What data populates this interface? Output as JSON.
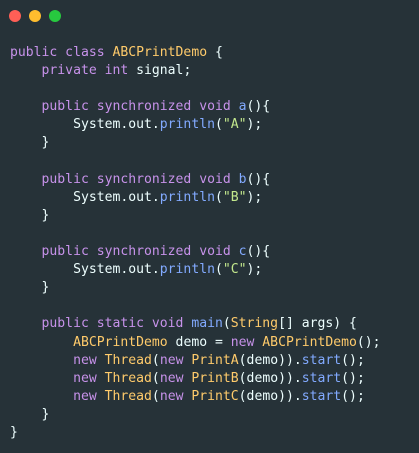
{
  "window": {
    "controls": [
      {
        "name": "close",
        "color": "#ff5f56"
      },
      {
        "name": "minimize",
        "color": "#ffbd2e"
      },
      {
        "name": "maximize",
        "color": "#27c93f"
      }
    ]
  },
  "colors": {
    "background": "#263238",
    "keyword": "#c792ea",
    "type": "#ffcb6b",
    "function": "#82aaff",
    "string": "#c3e88d",
    "text": "#eeffff",
    "punctuation": "#89ddff"
  },
  "code": {
    "lines": [
      [
        {
          "t": "public class ",
          "k": "keyword"
        },
        {
          "t": "ABCPrintDemo",
          "k": "type"
        },
        {
          "t": " {",
          "k": "plain"
        }
      ],
      [
        {
          "t": "    private int ",
          "k": "keyword"
        },
        {
          "t": "signal;",
          "k": "plain"
        }
      ],
      [],
      [
        {
          "t": "    public synchronized void ",
          "k": "keyword"
        },
        {
          "t": "a",
          "k": "func"
        },
        {
          "t": "(){",
          "k": "plain"
        }
      ],
      [
        {
          "t": "        System.out.",
          "k": "plain"
        },
        {
          "t": "println",
          "k": "func"
        },
        {
          "t": "(",
          "k": "plain"
        },
        {
          "t": "\"A\"",
          "k": "string"
        },
        {
          "t": ");",
          "k": "plain"
        }
      ],
      [
        {
          "t": "    }",
          "k": "plain"
        }
      ],
      [],
      [
        {
          "t": "    public synchronized void ",
          "k": "keyword"
        },
        {
          "t": "b",
          "k": "func"
        },
        {
          "t": "(){",
          "k": "plain"
        }
      ],
      [
        {
          "t": "        System.out.",
          "k": "plain"
        },
        {
          "t": "println",
          "k": "func"
        },
        {
          "t": "(",
          "k": "plain"
        },
        {
          "t": "\"B\"",
          "k": "string"
        },
        {
          "t": ");",
          "k": "plain"
        }
      ],
      [
        {
          "t": "    }",
          "k": "plain"
        }
      ],
      [],
      [
        {
          "t": "    public synchronized void ",
          "k": "keyword"
        },
        {
          "t": "c",
          "k": "func"
        },
        {
          "t": "(){",
          "k": "plain"
        }
      ],
      [
        {
          "t": "        System.out.",
          "k": "plain"
        },
        {
          "t": "println",
          "k": "func"
        },
        {
          "t": "(",
          "k": "plain"
        },
        {
          "t": "\"C\"",
          "k": "string"
        },
        {
          "t": ");",
          "k": "plain"
        }
      ],
      [
        {
          "t": "    }",
          "k": "plain"
        }
      ],
      [],
      [
        {
          "t": "    public static void ",
          "k": "keyword"
        },
        {
          "t": "main",
          "k": "func"
        },
        {
          "t": "(",
          "k": "plain"
        },
        {
          "t": "String",
          "k": "type"
        },
        {
          "t": "[] args) {",
          "k": "plain"
        }
      ],
      [
        {
          "t": "        ABCPrintDemo",
          "k": "type"
        },
        {
          "t": " demo = ",
          "k": "plain"
        },
        {
          "t": "new ",
          "k": "keyword"
        },
        {
          "t": "ABCPrintDemo",
          "k": "type"
        },
        {
          "t": "();",
          "k": "plain"
        }
      ],
      [
        {
          "t": "        new ",
          "k": "keyword"
        },
        {
          "t": "Thread",
          "k": "type"
        },
        {
          "t": "(",
          "k": "plain"
        },
        {
          "t": "new ",
          "k": "keyword"
        },
        {
          "t": "PrintA",
          "k": "type"
        },
        {
          "t": "(demo)).",
          "k": "plain"
        },
        {
          "t": "start",
          "k": "func"
        },
        {
          "t": "();",
          "k": "plain"
        }
      ],
      [
        {
          "t": "        new ",
          "k": "keyword"
        },
        {
          "t": "Thread",
          "k": "type"
        },
        {
          "t": "(",
          "k": "plain"
        },
        {
          "t": "new ",
          "k": "keyword"
        },
        {
          "t": "PrintB",
          "k": "type"
        },
        {
          "t": "(demo)).",
          "k": "plain"
        },
        {
          "t": "start",
          "k": "func"
        },
        {
          "t": "();",
          "k": "plain"
        }
      ],
      [
        {
          "t": "        new ",
          "k": "keyword"
        },
        {
          "t": "Thread",
          "k": "type"
        },
        {
          "t": "(",
          "k": "plain"
        },
        {
          "t": "new ",
          "k": "keyword"
        },
        {
          "t": "PrintC",
          "k": "type"
        },
        {
          "t": "(demo)).",
          "k": "plain"
        },
        {
          "t": "start",
          "k": "func"
        },
        {
          "t": "();",
          "k": "plain"
        }
      ],
      [
        {
          "t": "    }",
          "k": "plain"
        }
      ],
      [
        {
          "t": "}",
          "k": "plain"
        }
      ]
    ]
  }
}
